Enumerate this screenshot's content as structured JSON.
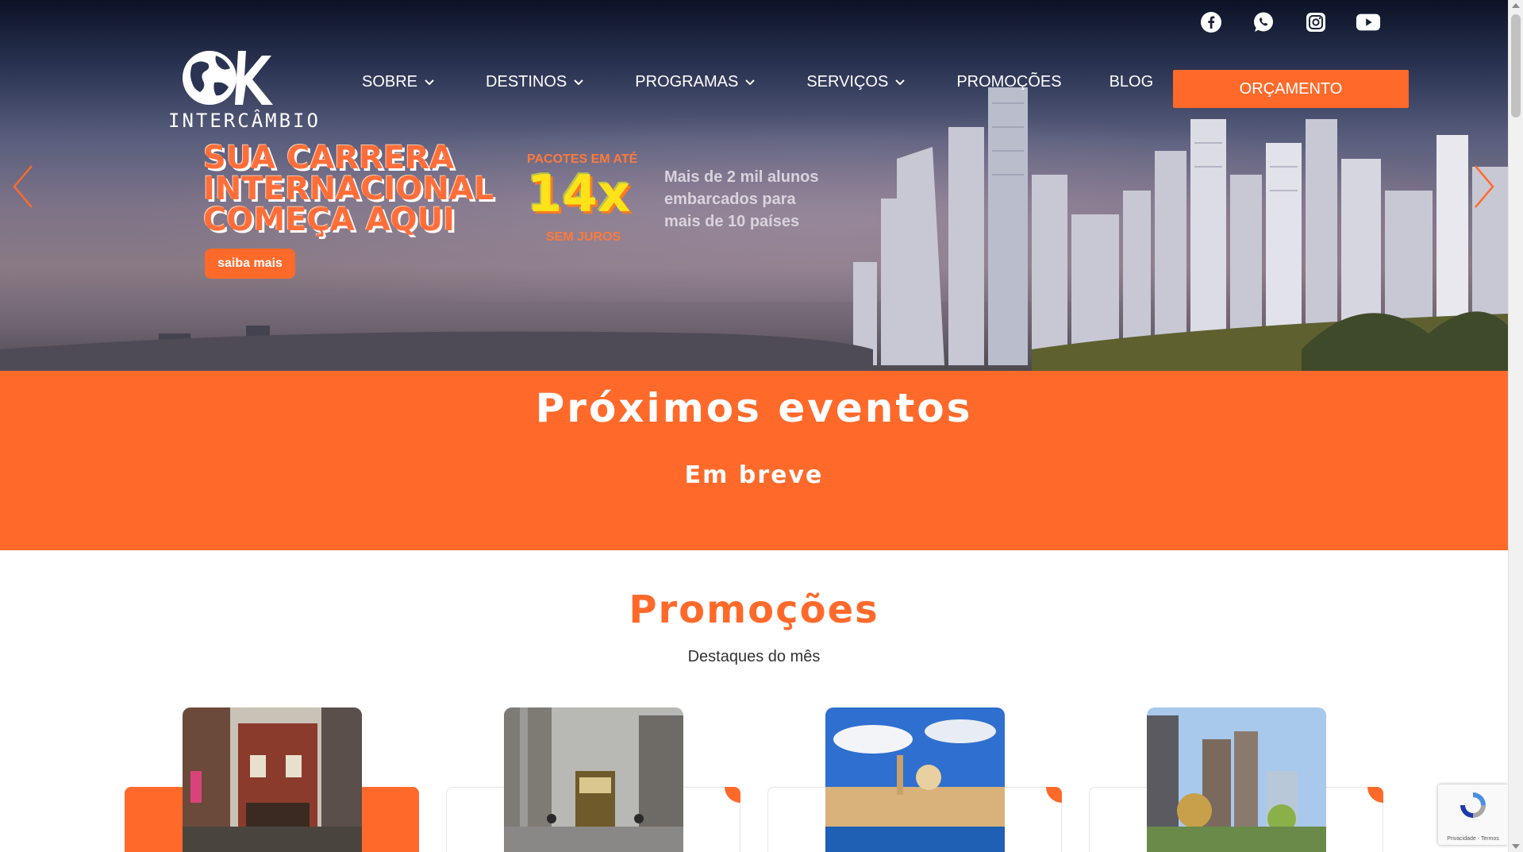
{
  "brand": {
    "logo_text": "INTERCÂMBIO",
    "accent_color": "#ff6a2b"
  },
  "social": [
    {
      "icon": "facebook-icon"
    },
    {
      "icon": "whatsapp-icon"
    },
    {
      "icon": "instagram-icon"
    },
    {
      "icon": "youtube-icon"
    }
  ],
  "nav": {
    "items": [
      {
        "label": "SOBRE",
        "has_dropdown": true
      },
      {
        "label": "DESTINOS",
        "has_dropdown": true
      },
      {
        "label": "PROGRAMAS",
        "has_dropdown": true
      },
      {
        "label": "SERVIÇOS",
        "has_dropdown": true
      },
      {
        "label": "PROMOÇÕES",
        "has_dropdown": false
      },
      {
        "label": "BLOG",
        "has_dropdown": false
      }
    ],
    "cta_label": "ORÇAMENTO"
  },
  "hero": {
    "headline_line1": "SUA CARRERA",
    "headline_line2": "INTERNACIONAL",
    "headline_line3": "COMEÇA AQUI",
    "cta_label": "saiba mais",
    "installments_top": "PACOTES EM ATÉ",
    "installments_value": "14x",
    "installments_bottom": "SEM JUROS",
    "stat_line1": "Mais de 2 mil alunos",
    "stat_line2": "embarcados para",
    "stat_line3": "mais de 10 países"
  },
  "events": {
    "title": "Próximos eventos",
    "status": "Em breve"
  },
  "promotions": {
    "title": "Promoções",
    "subtitle": "Destaques do mês"
  },
  "recaptcha": {
    "label": "Privacidade - Termos"
  }
}
